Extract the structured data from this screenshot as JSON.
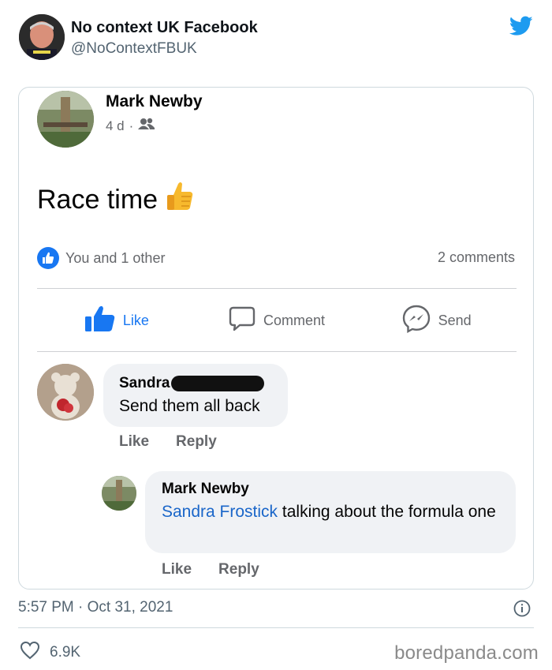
{
  "tweet": {
    "author_name": "No context UK Facebook",
    "author_handle": "@NoContextFBUK",
    "timestamp": "5:57 PM · Oct 31, 2021",
    "likes": "6.9K",
    "icons": [
      "twitter-bird-icon",
      "info-icon",
      "heart-icon"
    ]
  },
  "post": {
    "author": "Mark Newby",
    "age": "4 d",
    "separator": "·",
    "audience_icon": "friends-icon",
    "text": "Race time",
    "emoji": "thumbs-up-emoji",
    "reactions_text": "You and 1 other",
    "comments_count": "2 comments",
    "actions": {
      "like": "Like",
      "comment": "Comment",
      "send": "Send"
    }
  },
  "comments": [
    {
      "author": "Sandra",
      "text": "Send them all back",
      "like": "Like",
      "reply": "Reply"
    },
    {
      "author": "Mark Newby",
      "mention": "Sandra Frostick",
      "text": " talking about the formula one",
      "like": "Like",
      "reply": "Reply"
    }
  ],
  "watermark": "boredpanda.com",
  "colors": {
    "facebook_blue": "#1877f2",
    "twitter_blue": "#1d9bf0",
    "bubble_bg": "#f0f2f5",
    "mention": "#1a66c9"
  }
}
